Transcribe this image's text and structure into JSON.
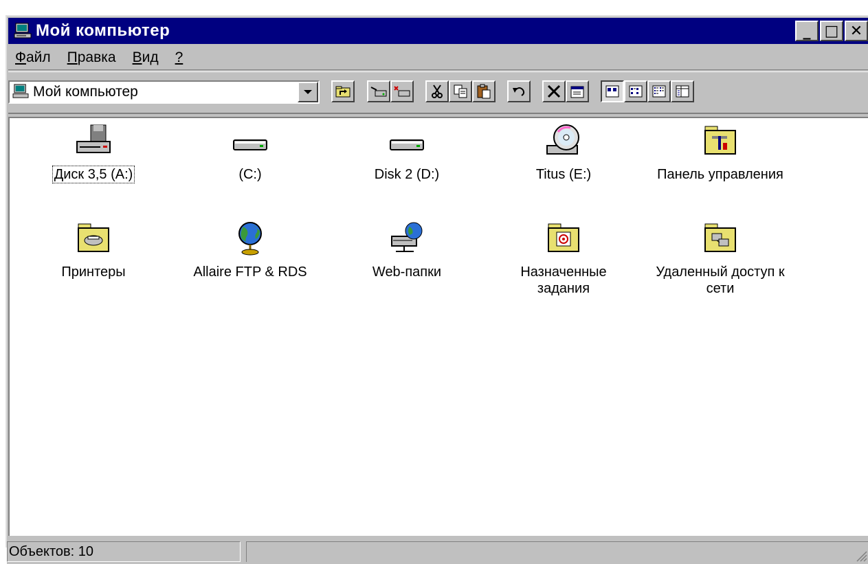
{
  "window": {
    "title": "Мой компьютер",
    "minimize_label": "_",
    "maximize_label": "□",
    "close_label": "✕"
  },
  "menu": [
    {
      "underline": "Ф",
      "rest": "айл"
    },
    {
      "underline": "П",
      "rest": "равка"
    },
    {
      "underline": "В",
      "rest": "ид"
    },
    {
      "underline": "?",
      "rest": ""
    }
  ],
  "address": {
    "value": "Мой компьютер",
    "icon": "my-computer-icon"
  },
  "toolbar": {
    "buttons": [
      "up-folder-icon",
      "map-drive-icon",
      "disconnect-drive-icon",
      "cut-icon",
      "copy-icon",
      "paste-icon",
      "undo-icon",
      "delete-icon",
      "properties-icon",
      "large-icons-icon",
      "small-icons-icon",
      "list-icon",
      "details-icon"
    ]
  },
  "items": [
    {
      "label": "Диск 3,5 (А:)",
      "icon": "floppy-drive-icon",
      "selected": true
    },
    {
      "label": "(C:)",
      "icon": "hard-drive-icon"
    },
    {
      "label": "Disk 2 (D:)",
      "icon": "hard-drive-icon"
    },
    {
      "label": "Titus (E:)",
      "icon": "cd-drive-icon"
    },
    {
      "label": "Панель управления",
      "icon": "control-panel-icon"
    },
    {
      "label": "Принтеры",
      "icon": "printers-folder-icon"
    },
    {
      "label": "Allaire FTP & RDS",
      "icon": "globe-icon"
    },
    {
      "label": "Web-папки",
      "icon": "web-folders-icon"
    },
    {
      "label": "Назначенные задания",
      "icon": "scheduled-tasks-icon"
    },
    {
      "label": "Удаленный доступ к сети",
      "icon": "dial-up-networking-icon"
    }
  ],
  "status": {
    "objects": "Объектов: 10"
  },
  "colors": {
    "title_bg": "#000080",
    "face": "#c0c0c0",
    "folder": "#e8e070"
  }
}
